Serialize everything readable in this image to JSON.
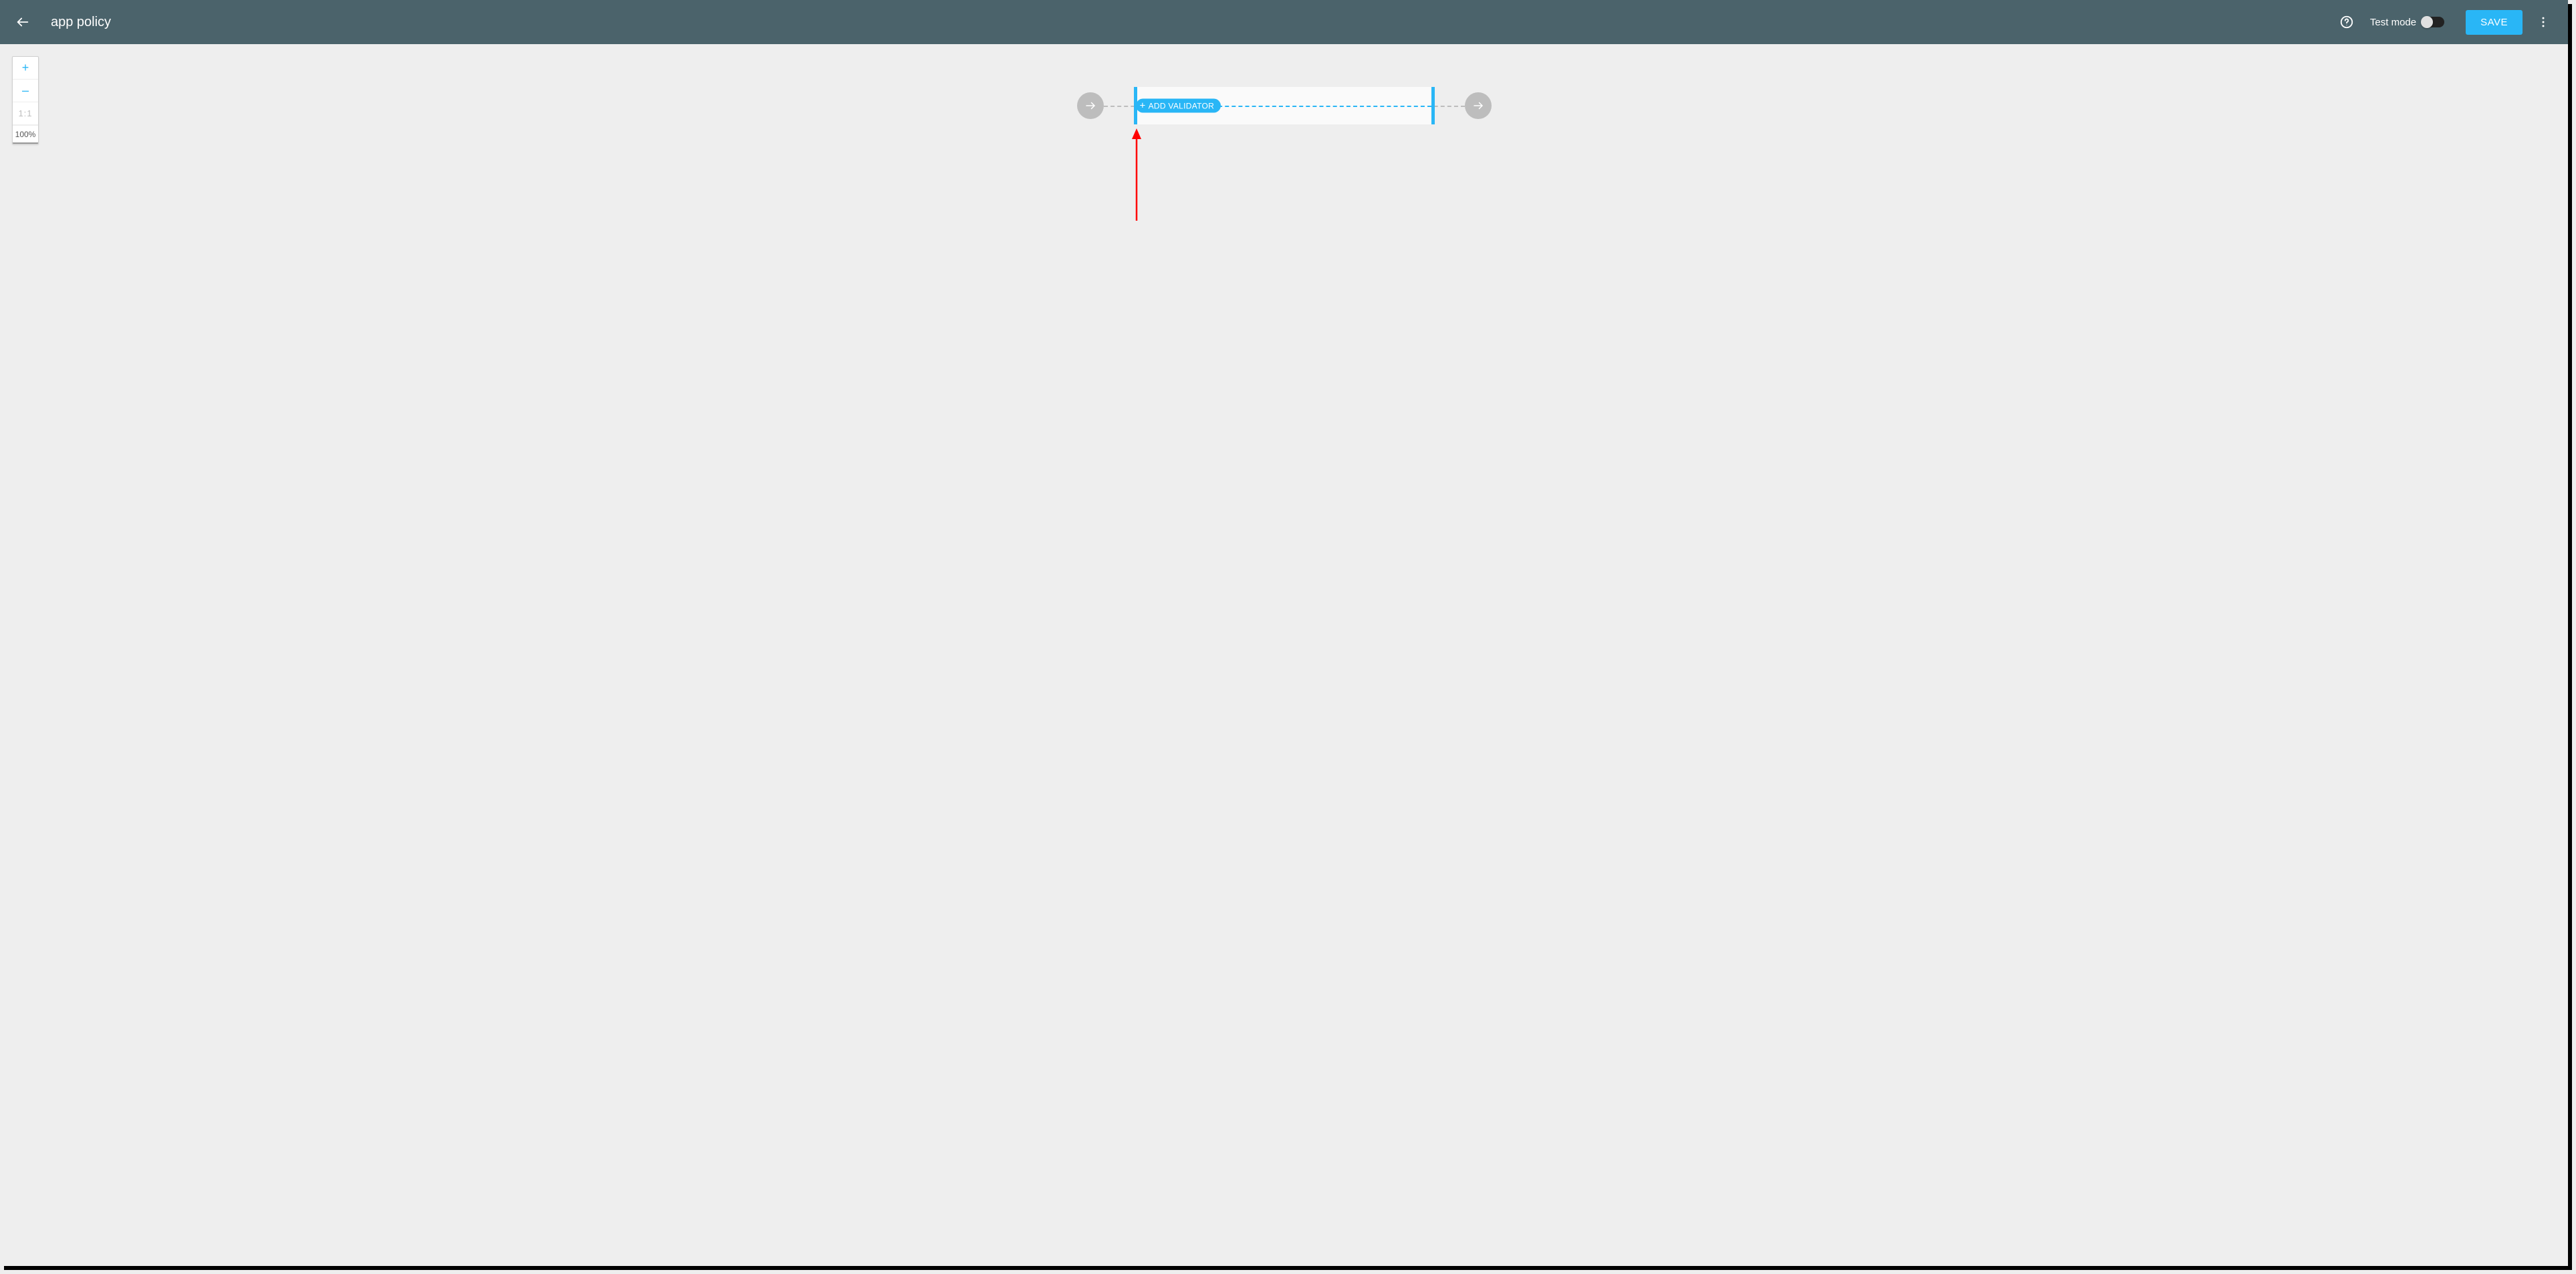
{
  "header": {
    "title": "app policy",
    "testmode_label": "Test mode",
    "testmode_on": false,
    "save_label": "SAVE"
  },
  "zoom": {
    "plus": "+",
    "minus": "–",
    "ratio": "1:1",
    "percent": "100%"
  },
  "pipeline": {
    "add_validator_label": "ADD VALIDATOR"
  },
  "colors": {
    "accent": "#29b6f6",
    "header_bg": "#4b636b",
    "annotation": "#ff0000"
  }
}
